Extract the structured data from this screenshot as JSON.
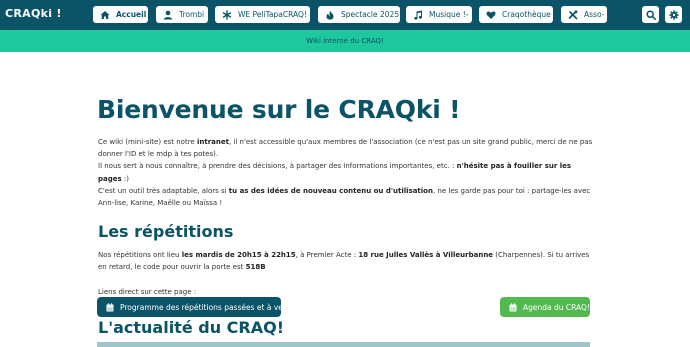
{
  "brand": "CRAQki !",
  "nav": [
    {
      "label": "Accueil",
      "icon": "home-icon"
    },
    {
      "label": "Trombi",
      "icon": "user-icon"
    },
    {
      "label": "WE PeliTapaCRAQ!",
      "icon": "asterisk-icon"
    },
    {
      "label": "Spectacle 2025",
      "icon": "fire-icon"
    },
    {
      "label": "Musique !-",
      "icon": "music-icon"
    },
    {
      "label": "Craqothèque",
      "icon": "heart-icon"
    },
    {
      "label": "Asso-",
      "icon": "tools-icon"
    }
  ],
  "banner": "Wiki interne du CRAQ!",
  "main": {
    "title": "Bienvenue sur le CRAQki !",
    "intro": {
      "t1": "Ce wiki (mini-site) est notre ",
      "b1": "intranet",
      "t2": ", il n'est accessible qu'aux membres de l'association (ce n'est pas un site grand public, merci de ne pas donner l'ID et le mdp à tes potes).",
      "t3": "Il nous sert à nous connaître, à prendre des décisions, à partager des informations importantes, etc. : ",
      "b2": "n'hésite pas à fouiller sur les pages",
      "t4": " :)"
    },
    "adapt": {
      "t1": "C'est un outil très adaptable, alors si ",
      "b1": "tu as des idées de nouveau contenu ou d'utilisation",
      "t2": ", ne les garde pas pour toi : partage-les avec Ann-lise, Karine, Maëlle ou Maïssa !"
    },
    "repetitions": {
      "heading": "Les répétitions",
      "t1": "Nos répétitions ont lieu ",
      "b1": "les mardis de 20h15 à 22h15",
      "t2": ", à Premier Acte : ",
      "b2": "18 rue Julles Vallès à Villeurbanne",
      "t3": " (Charpennes). Si tu arrives en retard, le code pour ouvrir la porte est ",
      "b3": "518B",
      "links_label": "Liens direct sur cette page :",
      "btn_program": "Programme des répétitions passées et à venir",
      "btn_agenda": "Agenda du CRAQ!"
    },
    "news_heading": "L'actualité du CRAQ!"
  },
  "colors": {
    "primary": "#0b5366",
    "banner": "#1fc79d",
    "green_button": "#52b94f"
  }
}
